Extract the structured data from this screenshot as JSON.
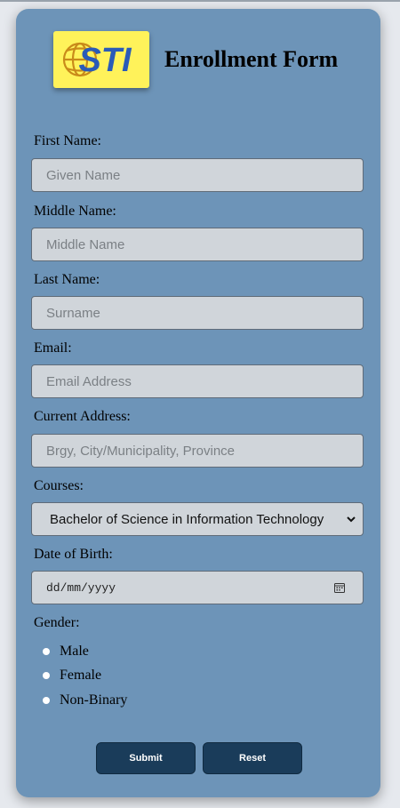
{
  "header": {
    "logo_text": "STI",
    "title": "Enrollment Form"
  },
  "form": {
    "first_name": {
      "label": "First Name:",
      "placeholder": "Given Name",
      "value": ""
    },
    "middle_name": {
      "label": "Middle Name:",
      "placeholder": "Middle Name",
      "value": ""
    },
    "last_name": {
      "label": "Last Name:",
      "placeholder": "Surname",
      "value": ""
    },
    "email": {
      "label": "Email:",
      "placeholder": "Email Address",
      "value": ""
    },
    "address": {
      "label": "Current Address:",
      "placeholder": "Brgy, City/Municipality, Province",
      "value": ""
    },
    "courses": {
      "label": "Courses:",
      "selected": "Bachelor of Science in Information Technology"
    },
    "dob": {
      "label": "Date of Birth:",
      "placeholder": "dd/mm/yyyy"
    },
    "gender": {
      "label": "Gender:",
      "options": [
        "Male",
        "Female",
        "Non-Binary"
      ]
    }
  },
  "buttons": {
    "submit": "Submit",
    "reset": "Reset"
  },
  "colors": {
    "card": "#6d94b8",
    "field": "#d0d5da",
    "button": "#1a3c5a",
    "logo_bg": "#fff25a",
    "logo_text": "#2a5bb8"
  }
}
